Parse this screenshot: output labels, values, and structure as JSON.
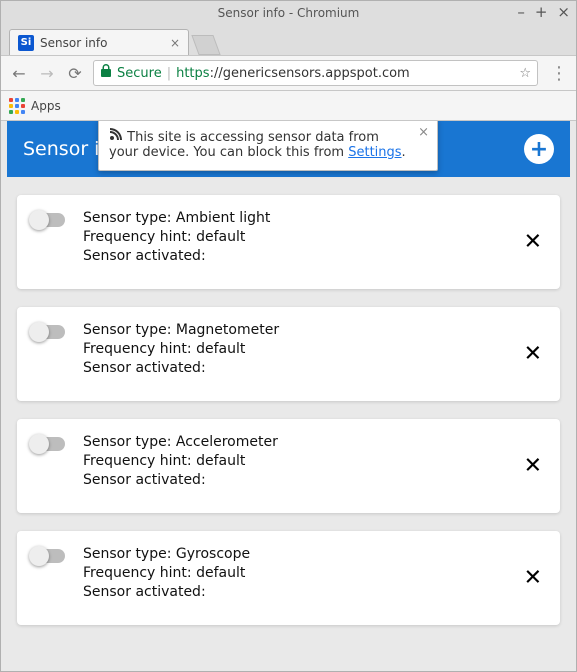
{
  "window": {
    "title": "Sensor info - Chromium"
  },
  "tab": {
    "title": "Sensor info",
    "favicon_text": "Si"
  },
  "omnibox": {
    "secure_label": "Secure",
    "scheme": "https",
    "host_path": "://genericsensors.appspot.com"
  },
  "bookmarks": {
    "apps_label": "Apps"
  },
  "infobar": {
    "text_pre": "This site is accessing sensor data from your device. You can block this from ",
    "link_text": "Settings",
    "text_post": "."
  },
  "app": {
    "header_title": "Sensor info"
  },
  "labels": {
    "type_prefix": "Sensor type: ",
    "freq_prefix": "Frequency hint: ",
    "activated_prefix": "Sensor activated:"
  },
  "sensors": [
    {
      "type": "Ambient light",
      "freq": "default",
      "activated": ""
    },
    {
      "type": "Magnetometer",
      "freq": "default",
      "activated": ""
    },
    {
      "type": "Accelerometer",
      "freq": "default",
      "activated": ""
    },
    {
      "type": "Gyroscope",
      "freq": "default",
      "activated": ""
    }
  ]
}
